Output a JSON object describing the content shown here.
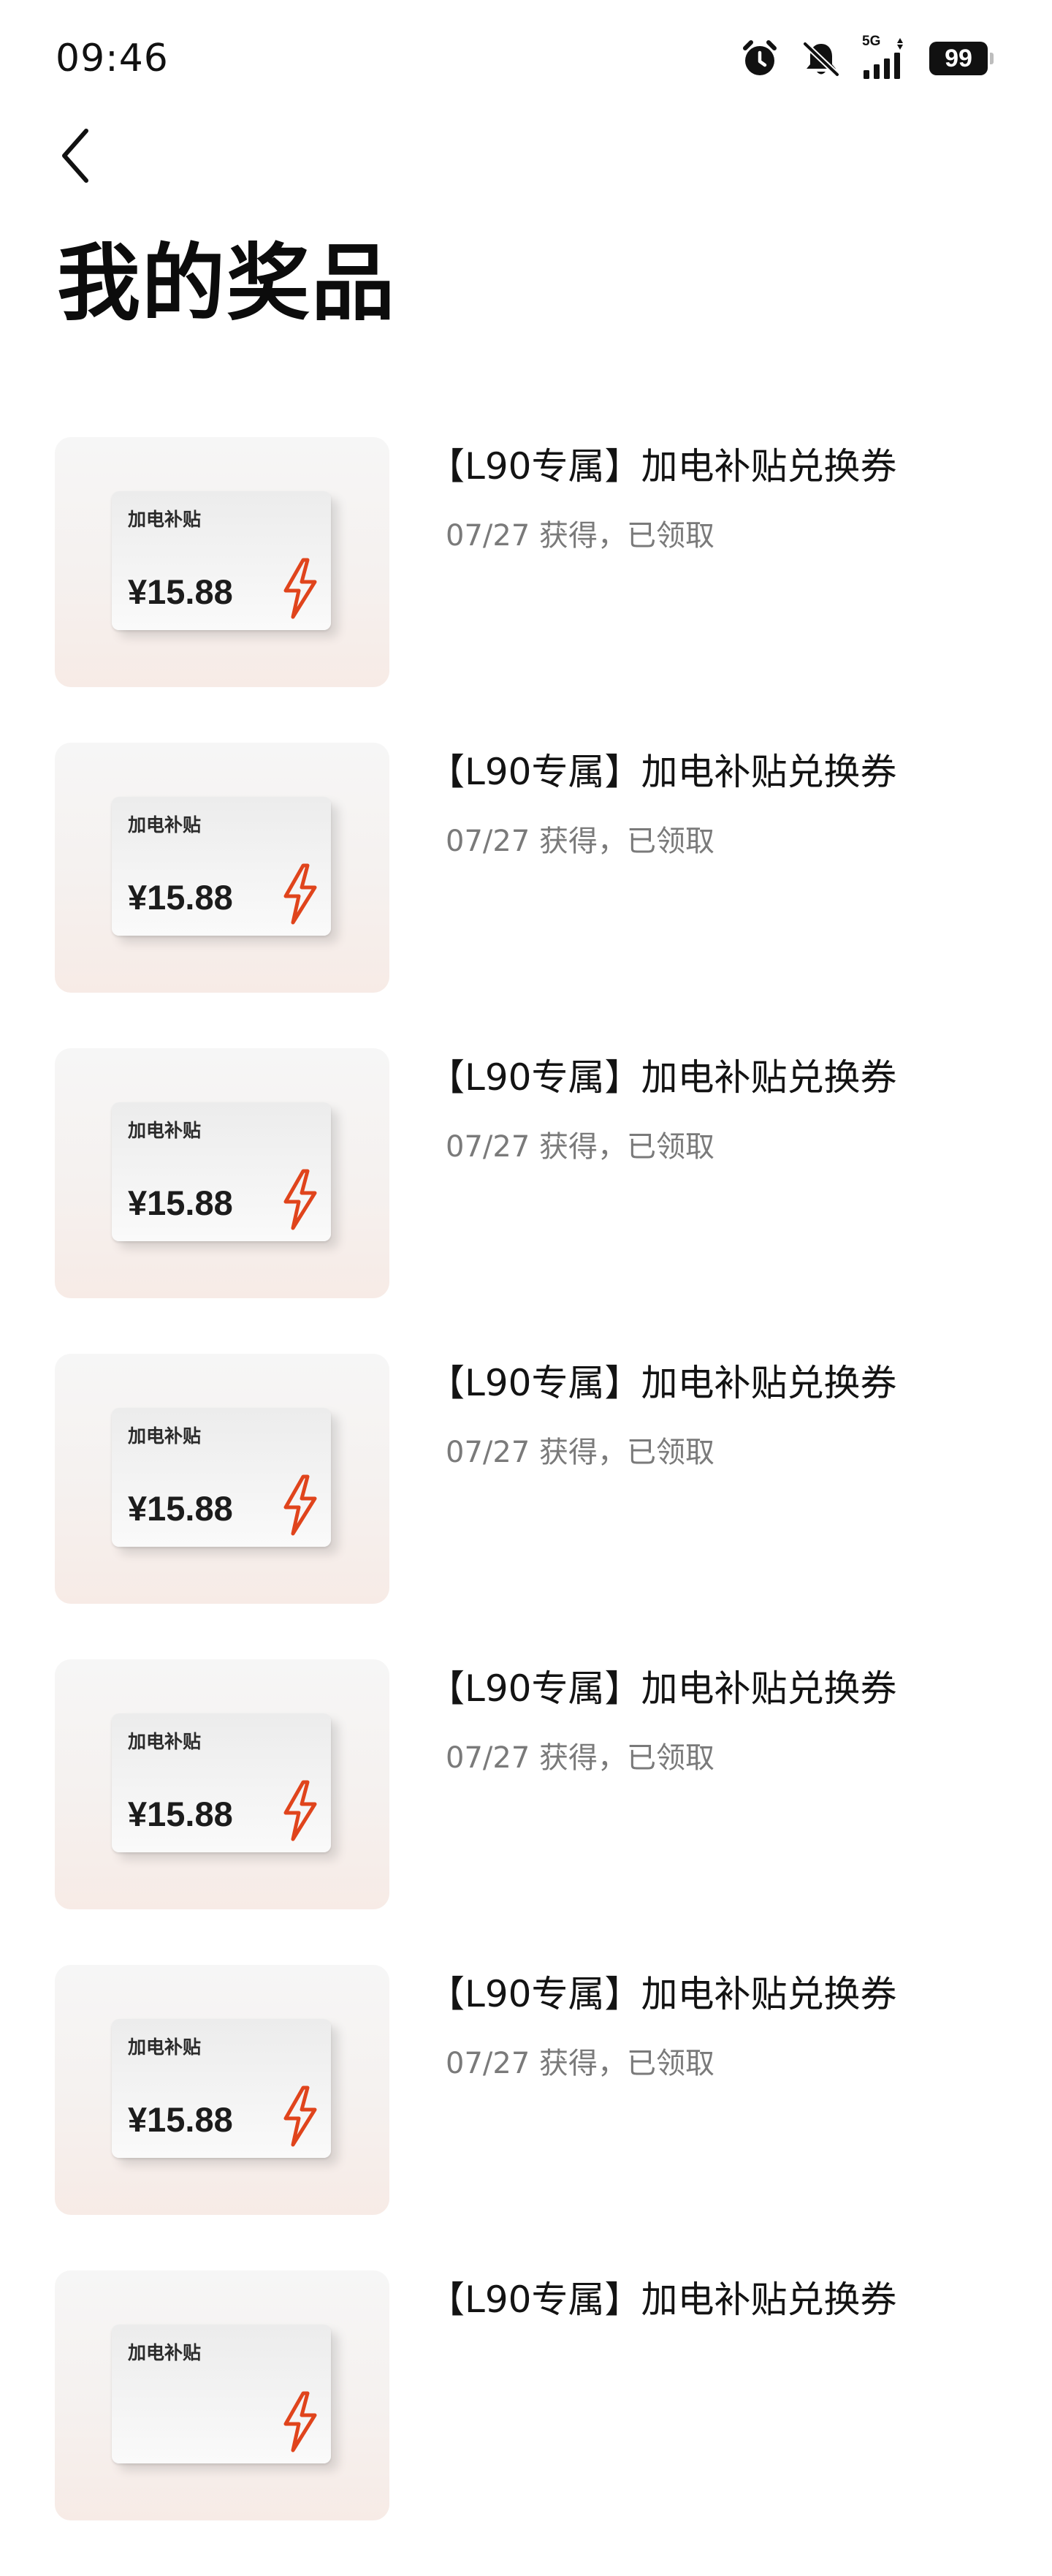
{
  "status_bar": {
    "time": "09:46",
    "network": "5G",
    "battery": "99",
    "icons": [
      "alarm-icon",
      "mute-icon",
      "signal-icon",
      "battery-icon"
    ]
  },
  "header": {
    "back_icon": "chevron-left-icon",
    "title": "我的奖品"
  },
  "colors": {
    "accent": "#e0441c",
    "status_text": "#7a7a7a"
  },
  "prizes": [
    {
      "card_label": "加电补贴",
      "card_amount": "¥15.88",
      "title": "【L90专属】加电补贴兑换券",
      "status": "07/27 获得，已领取"
    },
    {
      "card_label": "加电补贴",
      "card_amount": "¥15.88",
      "title": "【L90专属】加电补贴兑换券",
      "status": "07/27 获得，已领取"
    },
    {
      "card_label": "加电补贴",
      "card_amount": "¥15.88",
      "title": "【L90专属】加电补贴兑换券",
      "status": "07/27 获得，已领取"
    },
    {
      "card_label": "加电补贴",
      "card_amount": "¥15.88",
      "title": "【L90专属】加电补贴兑换券",
      "status": "07/27 获得，已领取"
    },
    {
      "card_label": "加电补贴",
      "card_amount": "¥15.88",
      "title": "【L90专属】加电补贴兑换券",
      "status": "07/27 获得，已领取"
    },
    {
      "card_label": "加电补贴",
      "card_amount": "¥15.88",
      "title": "【L90专属】加电补贴兑换券",
      "status": "07/27 获得，已领取"
    },
    {
      "card_label": "加电补贴",
      "card_amount": "",
      "title": "【L90专属】加电补贴兑换券",
      "status": ""
    }
  ]
}
